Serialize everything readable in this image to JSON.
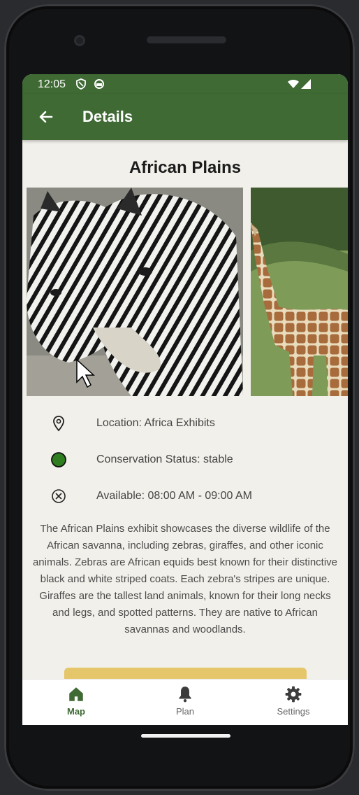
{
  "status_bar": {
    "time": "12:05",
    "icons": [
      "shield-icon",
      "sync-icon",
      "wifi-icon",
      "signal-icon"
    ]
  },
  "app_bar": {
    "title": "Details",
    "back_icon": "arrow-back-icon"
  },
  "exhibit": {
    "title": "African Plains",
    "photos": [
      "zebra-photo",
      "giraffe-photo"
    ]
  },
  "info": {
    "location": "Location: Africa Exhibits",
    "conservation": "Conservation Status: stable",
    "available": "Available: 08:00 AM - 09:00 AM"
  },
  "description": {
    "paragraph1": "The African Plains exhibit showcases the diverse wildlife of the African savanna, including zebras, giraffes, and other iconic animals. Zebras are African equids best known for their distinctive black and white striped coats. Each zebra's stripes are unique.",
    "paragraph2": "Giraffes are the tallest land animals, known for their long necks and legs, and spotted patterns. They are native to African savannas and woodlands."
  },
  "bottom_nav": {
    "items": [
      {
        "label": "Map",
        "icon": "home-icon",
        "active": true
      },
      {
        "label": "Plan",
        "icon": "bell-icon",
        "active": false
      },
      {
        "label": "Settings",
        "icon": "gear-icon",
        "active": false
      }
    ]
  },
  "colors": {
    "primary": "#3f6a34",
    "background": "#f2f0ea",
    "status_dot": "#2e7d1f",
    "button": "#e6c66a"
  }
}
